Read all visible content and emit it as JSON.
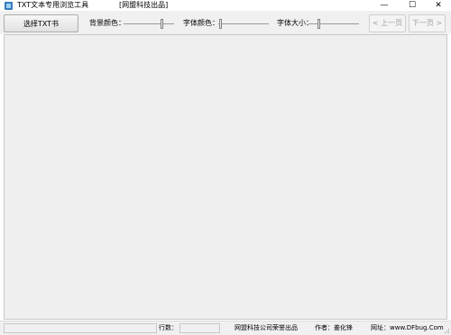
{
  "window": {
    "title": "TXT文本专用浏览工具",
    "subtitle": "[网盟科技出品]",
    "minimize_glyph": "—",
    "maximize_glyph": "☐",
    "close_glyph": "✕"
  },
  "toolbar": {
    "select_button": "选择TXT书",
    "bg_color_label": "背景颜色：",
    "font_color_label": "字体颜色：",
    "font_size_label": "字体大小：",
    "prev_button": "< 上一页",
    "next_button": "下一页 >"
  },
  "statusbar": {
    "lines_label": "行数：",
    "lines_value": "",
    "company": "网盟科技公司荣誉出品",
    "author": "作者：姜化锋",
    "website": "网址：www.DFbug.Com"
  },
  "colors": {
    "toolbar_bg": "#f0f0f0",
    "content_bg": "#efefef",
    "disabled_text": "#a0a0a0"
  }
}
